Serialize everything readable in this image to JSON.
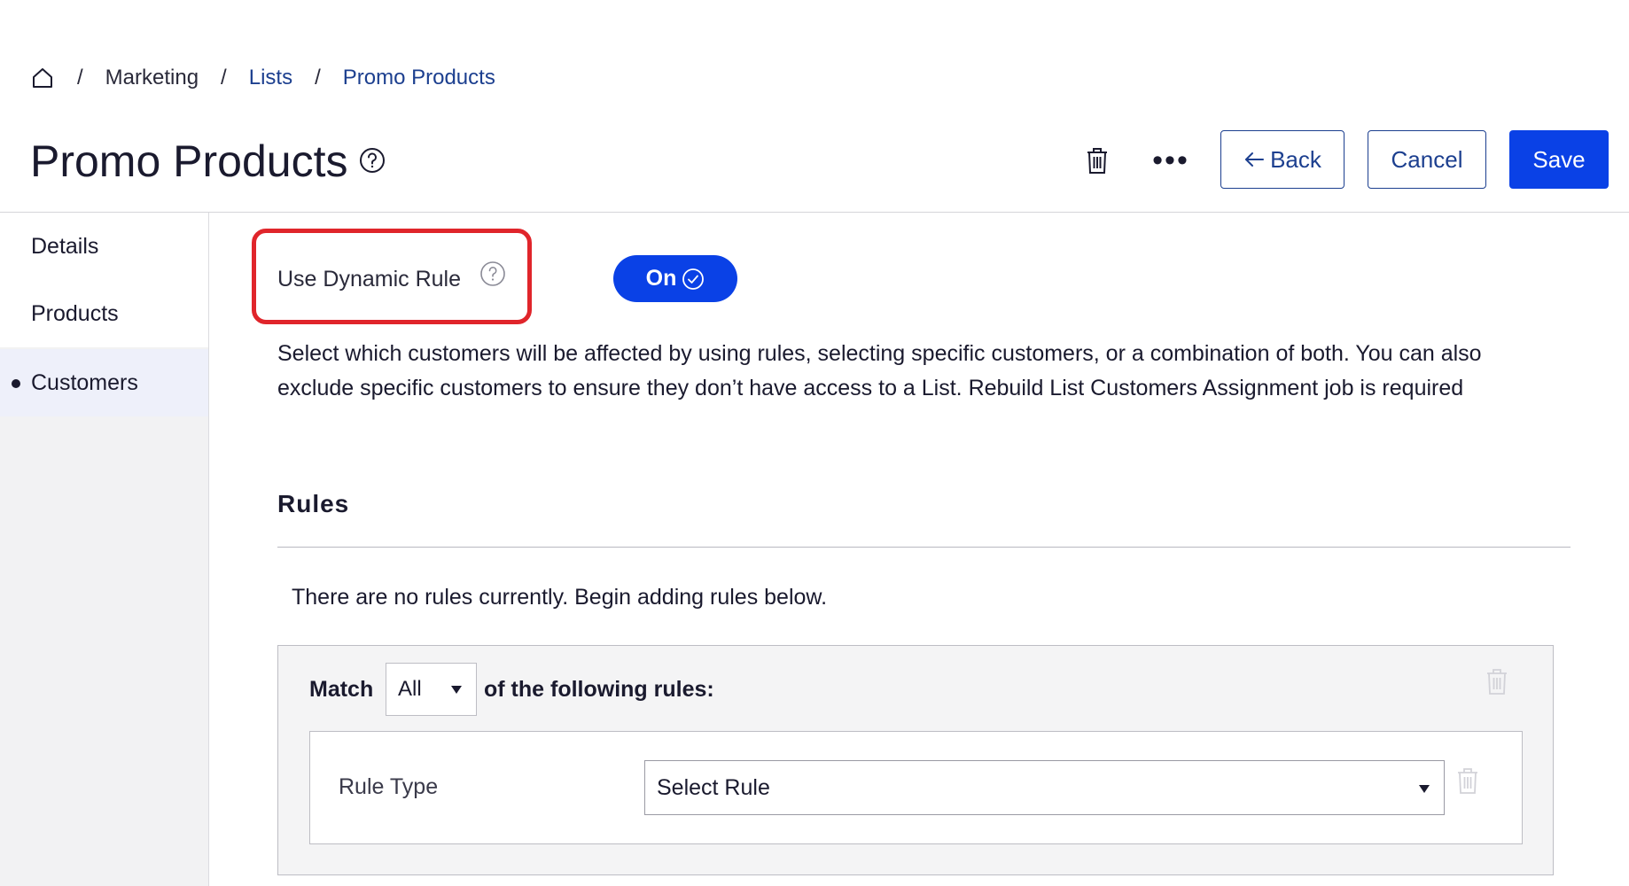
{
  "breadcrumb": {
    "home_icon": "home-icon",
    "items": [
      {
        "label": "Marketing"
      },
      {
        "label": "Lists"
      },
      {
        "label": "Promo Products"
      }
    ]
  },
  "header": {
    "title": "Promo Products",
    "help_icon": "question-circle-icon",
    "delete_icon": "trash-icon",
    "more_icon": "more-horizontal-icon",
    "more_glyph": "•••",
    "back_label": "Back",
    "back_icon": "arrow-left-icon",
    "cancel_label": "Cancel",
    "save_label": "Save"
  },
  "sidebar": {
    "items": [
      {
        "label": "Details",
        "active": false
      },
      {
        "label": "Products",
        "active": false
      },
      {
        "label": "Customers",
        "active": true
      }
    ]
  },
  "dynamic_rule": {
    "label": "Use Dynamic Rule",
    "help_icon": "question-circle-icon",
    "toggle_label": "On",
    "toggle_icon": "check-circle-icon",
    "toggle_state": true
  },
  "description": "Select which customers will be affected by using rules, selecting specific customers, or a combination of both. You can also exclude specific customers to ensure they don’t have access to a List. Rebuild List Customers Assignment job is required",
  "rules": {
    "heading": "Rules",
    "empty_message": "There are no rules currently. Begin adding rules below.",
    "group": {
      "match_label": "Match",
      "match_value": "All",
      "following_label": "of the following rules:",
      "delete_icon": "trash-icon",
      "rule": {
        "type_label": "Rule Type",
        "select_value": "Select Rule",
        "delete_icon": "trash-icon"
      }
    }
  },
  "colors": {
    "accent": "#0a41e6",
    "link": "#1c3f8f",
    "highlight": "#e0252b"
  }
}
